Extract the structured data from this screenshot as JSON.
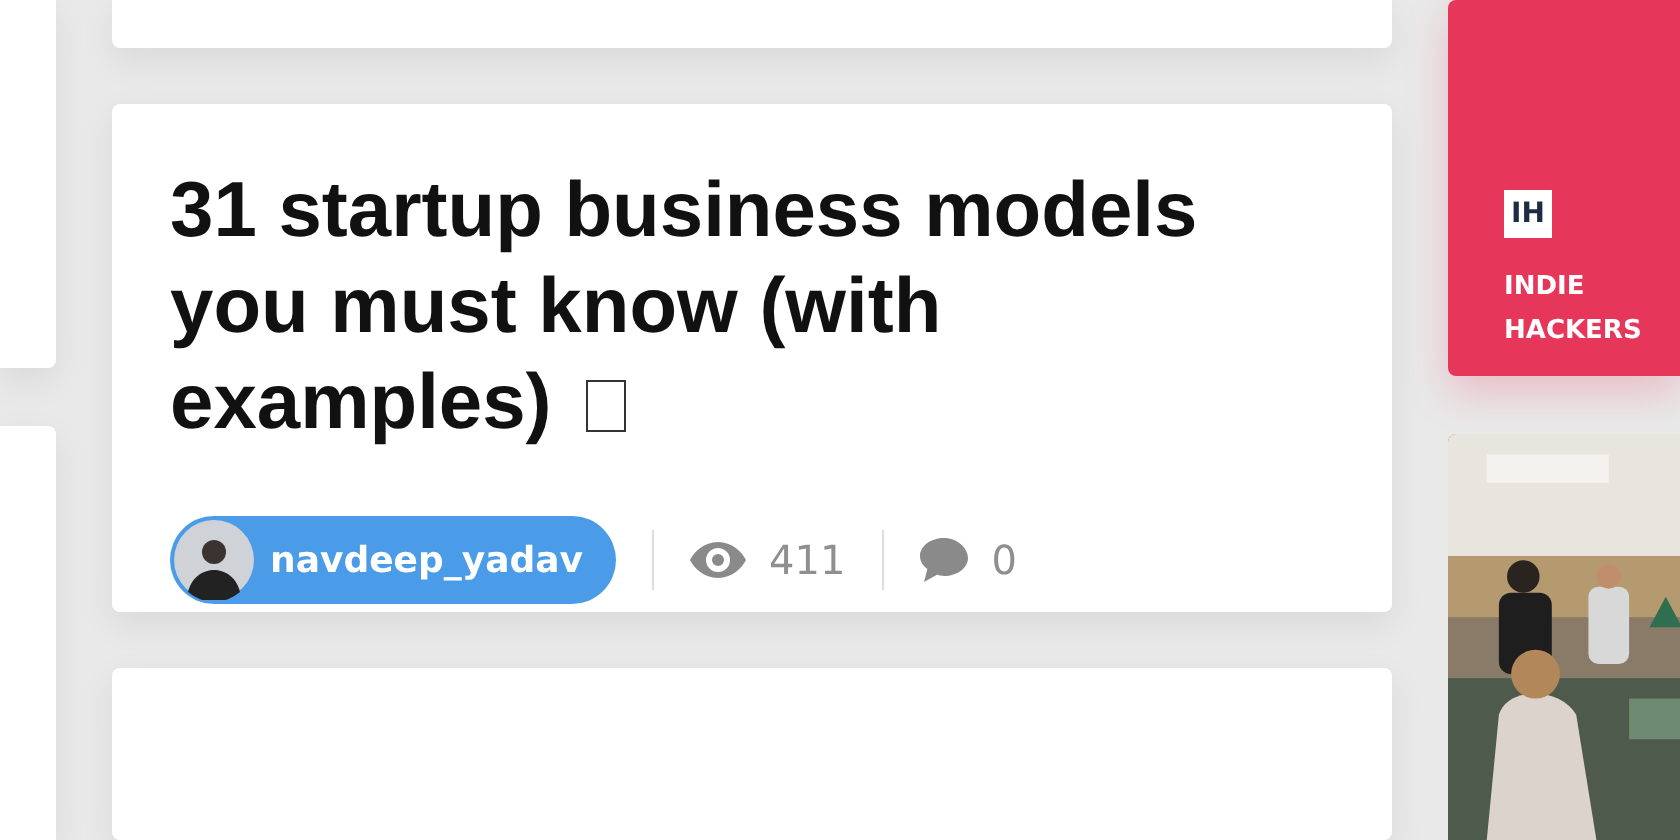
{
  "post": {
    "title": "31 startup business models you must know (with examples)",
    "author": {
      "name": "navdeep_yadav"
    },
    "views": "411",
    "comments": "0"
  },
  "sponsor": {
    "logo": "IH",
    "name": "INDIE HACKERS"
  }
}
